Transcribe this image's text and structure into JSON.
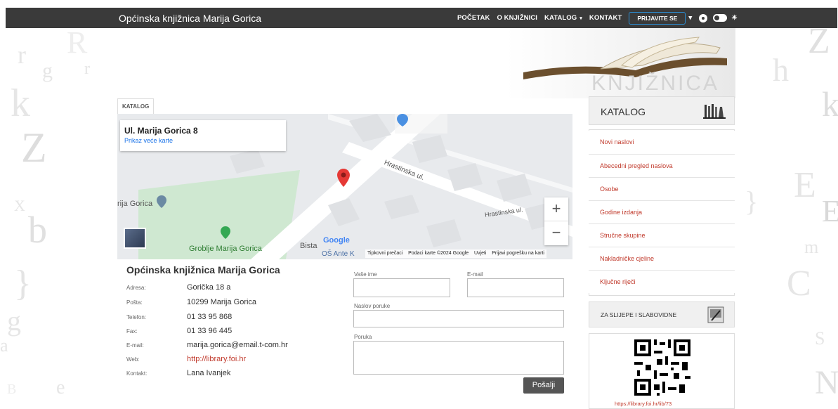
{
  "site": {
    "title": "Općinska knjižnica Marija Gorica"
  },
  "nav": {
    "items": [
      "POČETAK",
      "O KNJIŽNICI",
      "KATALOG",
      "KONTAKT"
    ],
    "login_label": "PRIJAVITE SE"
  },
  "header": {
    "logo_text": "KNJIŽNICA"
  },
  "tab": {
    "label": "KATALOG"
  },
  "map": {
    "card_title": "Ul. Marija Gorica 8",
    "card_link": "Prikaz veće karte",
    "street_1": "Hrastinska ul.",
    "street_2": "Hrastinska ul.",
    "place_left": "rija Gorica",
    "cemetery": "Groblje Marija Gorica",
    "bista": "Bista",
    "school": "OŠ Ante K",
    "google": "Google",
    "footer": "Tipkovni prečaci    Podaci karte ©2024 Google    Uvjeti    Prijavi pogrešku na karti",
    "zoom_in": "+",
    "zoom_out": "−"
  },
  "contact": {
    "title": "Općinska knjižnica Marija Gorica",
    "rows": [
      {
        "label": "Adresa:",
        "value": "Gorička 18 a"
      },
      {
        "label": "Pošta:",
        "value": "10299 Marija Gorica"
      },
      {
        "label": "Telefon:",
        "value": "01 33 95 868"
      },
      {
        "label": "Fax:",
        "value": "01 33 96 445"
      },
      {
        "label": "E-mail:",
        "value": "marija.gorica@email.t-com.hr"
      },
      {
        "label": "Web:",
        "value": "http://library.foi.hr"
      },
      {
        "label": "Kontakt:",
        "value": "Lana Ivanjek"
      }
    ]
  },
  "form": {
    "name_label": "Vaše ime",
    "email_label": "E-mail",
    "subject_label": "Naslov poruke",
    "message_label": "Poruka",
    "send_label": "Pošalji"
  },
  "sidebar": {
    "heading": "KATALOG",
    "items": [
      "Novi naslovi",
      "Abecedni pregled naslova",
      "Osobe",
      "Godine izdanja",
      "Stručne skupine",
      "Nakladničke cjeline",
      "Ključne riječi"
    ],
    "accessibility_label": "ZA SLIJEPE I SLABOVIDNE",
    "qr_url": "https://library.foi.hr/lib/73"
  },
  "colors": {
    "topbar": "#3a3a3a",
    "accent_red": "#c0392b",
    "link_blue": "#1a73e8"
  }
}
